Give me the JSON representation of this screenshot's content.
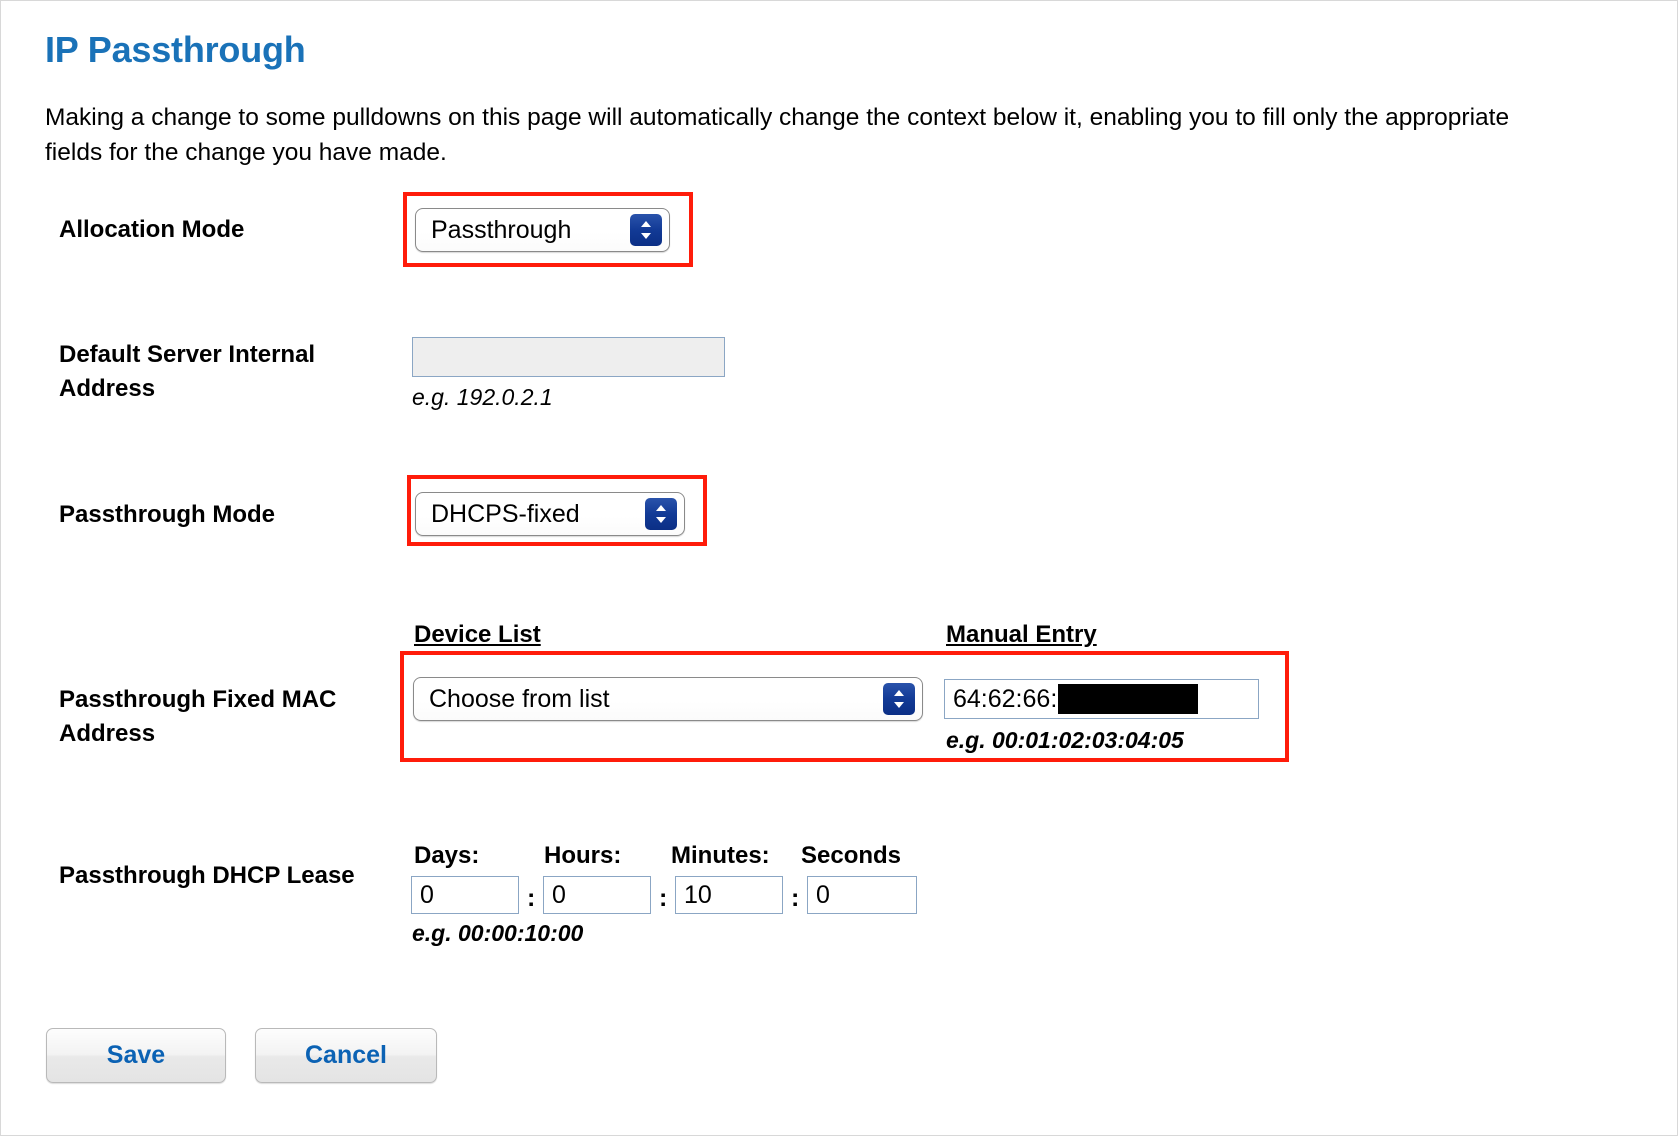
{
  "page": {
    "title": "IP Passthrough",
    "intro": "Making a change to some pulldowns on this page will automatically change the context below it, enabling you to fill only the appropriate fields for the change you have made."
  },
  "colors": {
    "title_blue": "#1a72b8",
    "highlight_red": "#ff1c0a",
    "select_knob_blue": "#123a96",
    "button_text_blue": "#0b62b4",
    "input_border": "#8ba6c4",
    "disabled_input_bg": "#eeeeee"
  },
  "fields": {
    "allocation_mode": {
      "label": "Allocation Mode",
      "value": "Passthrough",
      "highlighted": true
    },
    "default_server_internal_address": {
      "label": "Default Server Internal Address",
      "value": "",
      "placeholder": "",
      "hint": "e.g. 192.0.2.1",
      "disabled": true
    },
    "passthrough_mode": {
      "label": "Passthrough Mode",
      "value": "DHCPS-fixed",
      "highlighted": true
    },
    "passthrough_fixed_mac": {
      "label": "Passthrough Fixed MAC Address",
      "device_list_header": "Device List",
      "manual_entry_header": "Manual Entry",
      "device_list_value": "Choose from list",
      "manual_entry_value": "64:62:66:",
      "manual_entry_redacted": true,
      "hint": "e.g. 00:01:02:03:04:05",
      "highlighted": true
    },
    "passthrough_dhcp_lease": {
      "label": "Passthrough DHCP Lease",
      "hint": "e.g. 00:00:10:00",
      "separator": ":",
      "units": [
        {
          "name": "days",
          "label": "Days:",
          "value": "0"
        },
        {
          "name": "hours",
          "label": "Hours:",
          "value": "0"
        },
        {
          "name": "minutes",
          "label": "Minutes:",
          "value": "10"
        },
        {
          "name": "seconds",
          "label": "Seconds",
          "value": "0"
        }
      ]
    }
  },
  "actions": {
    "save_label": "Save",
    "cancel_label": "Cancel"
  },
  "icons": {
    "select_chevrons": "chevron-up-down-icon"
  }
}
